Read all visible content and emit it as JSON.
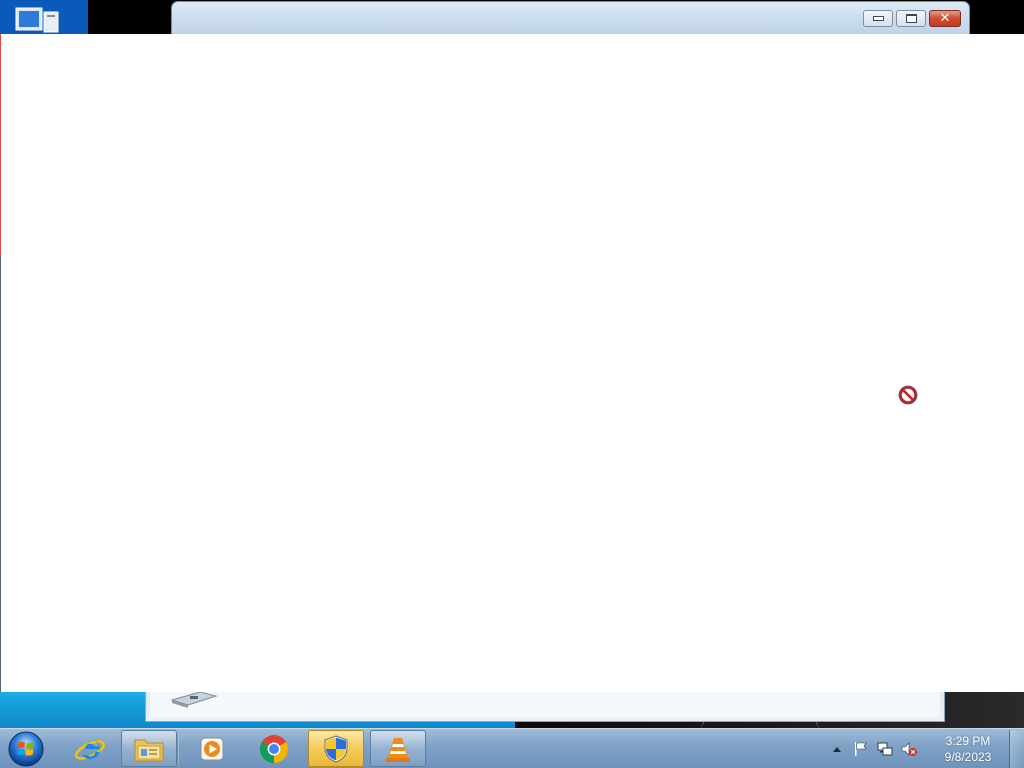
{
  "desktop": {
    "icon_name": "computer-icon"
  },
  "background_window": {
    "controls": {
      "minimize_icon": "minimize-icon",
      "maximize_icon": "maximize-icon",
      "close_icon": "close-icon",
      "close_glyph": "✕"
    },
    "bottom_icon": "drive-icon"
  },
  "foreground_panel": {
    "background_color": "#ffffff",
    "cursor_icon": "unavailable-cursor-icon"
  },
  "taskbar": {
    "start_icon": "windows-start-orb-icon",
    "buttons": [
      {
        "name": "internet-explorer",
        "icon": "internet-explorer-icon",
        "state": "pinned"
      },
      {
        "name": "windows-explorer",
        "icon": "folder-explorer-icon",
        "state": "open"
      },
      {
        "name": "windows-media-player",
        "icon": "media-player-icon",
        "state": "pinned"
      },
      {
        "name": "google-chrome",
        "icon": "chrome-icon",
        "state": "pinned"
      },
      {
        "name": "user-account-control",
        "icon": "uac-shield-icon",
        "state": "active"
      },
      {
        "name": "vlc-media-player",
        "icon": "vlc-cone-icon",
        "state": "open"
      }
    ],
    "tray": {
      "show_hidden_icon": "tray-expand-arrow-icon",
      "icons": [
        "action-center-flag-icon",
        "network-icon",
        "volume-muted-icon"
      ],
      "clock": {
        "time": "3:29 PM",
        "date": "9/8/2023"
      }
    },
    "colors": {
      "active_button": "#f4cc59",
      "taskbar_top": "#9fbbd8"
    }
  }
}
